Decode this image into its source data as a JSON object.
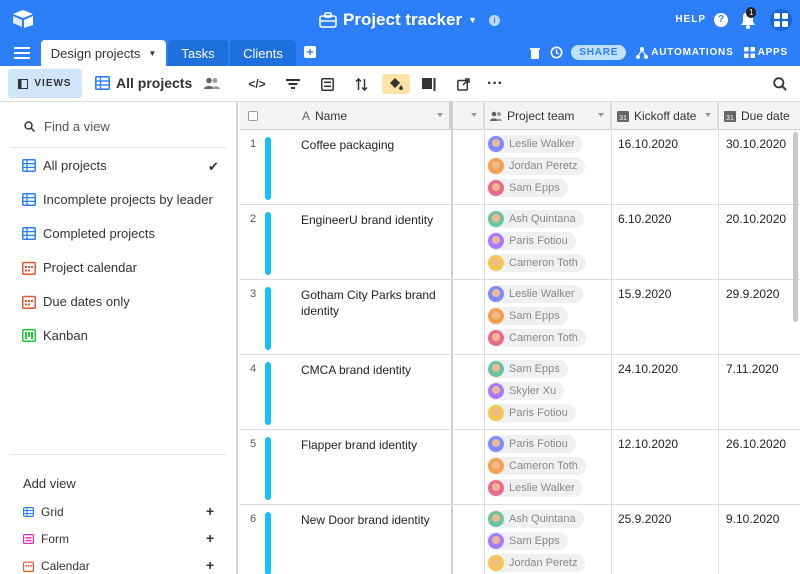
{
  "app": {
    "title": "Project tracker",
    "help_label": "HELP",
    "notification_count": "1"
  },
  "tabs": [
    {
      "label": "Design projects"
    },
    {
      "label": "Tasks"
    },
    {
      "label": "Clients"
    }
  ],
  "tab_actions": {
    "share_label": "SHARE",
    "automations_label": "AUTOMATIONS",
    "apps_label": "APPS"
  },
  "viewbar": {
    "views_label": "VIEWS",
    "current_view": "All projects"
  },
  "sidebar": {
    "find_placeholder": "Find a view",
    "views": [
      {
        "label": "All projects",
        "icon": "grid-icon",
        "selected": true
      },
      {
        "label": "Incomplete projects by leader",
        "icon": "grid-icon"
      },
      {
        "label": "Completed projects",
        "icon": "grid-icon"
      },
      {
        "label": "Project calendar",
        "icon": "calendar-icon"
      },
      {
        "label": "Due dates only",
        "icon": "calendar-icon"
      },
      {
        "label": "Kanban",
        "icon": "kanban-icon"
      }
    ],
    "add_view_label": "Add view",
    "add_options": [
      {
        "label": "Grid",
        "icon": "grid-icon"
      },
      {
        "label": "Form",
        "icon": "form-icon"
      },
      {
        "label": "Calendar",
        "icon": "calendar-icon"
      }
    ]
  },
  "columns": {
    "name": "Name",
    "team": "Project team",
    "kickoff": "Kickoff date",
    "due": "Due date"
  },
  "rows": [
    {
      "num": "1",
      "name": "Coffee packaging",
      "team": [
        "Leslie Walker",
        "Jordan Peretz",
        "Sam Epps"
      ],
      "kickoff": "16.10.2020",
      "due": "30.10.2020"
    },
    {
      "num": "2",
      "name": "EngineerU brand identity",
      "team": [
        "Ash Quintana",
        "Paris Fotiou",
        "Cameron Toth"
      ],
      "kickoff": "6.10.2020",
      "due": "20.10.2020"
    },
    {
      "num": "3",
      "name": "Gotham City Parks brand identity",
      "team": [
        "Leslie Walker",
        "Sam Epps",
        "Cameron Toth"
      ],
      "kickoff": "15.9.2020",
      "due": "29.9.2020"
    },
    {
      "num": "4",
      "name": "CMCA brand identity",
      "team": [
        "Sam Epps",
        "Skyler Xu",
        "Paris Fotiou"
      ],
      "kickoff": "24.10.2020",
      "due": "7.11.2020"
    },
    {
      "num": "5",
      "name": "Flapper brand identity",
      "team": [
        "Paris Fotiou",
        "Cameron Toth",
        "Leslie Walker"
      ],
      "kickoff": "12.10.2020",
      "due": "26.10.2020"
    },
    {
      "num": "6",
      "name": "New Door brand identity",
      "team": [
        "Ash Quintana",
        "Sam Epps",
        "Jordan Peretz"
      ],
      "kickoff": "25.9.2020",
      "due": "9.10.2020"
    }
  ],
  "colors": {
    "brand_blue": "#2d7ff9",
    "bar_color": "#18bfff",
    "highlight": "#ffe2a6"
  }
}
